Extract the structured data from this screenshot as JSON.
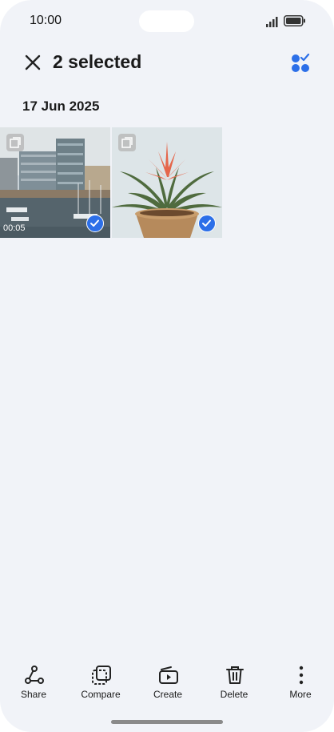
{
  "status": {
    "time": "10:00"
  },
  "header": {
    "title": "2 selected",
    "close_icon": "close-icon",
    "select_all_icon": "select-all-icon"
  },
  "section": {
    "date": "17 Jun 2025"
  },
  "photos": [
    {
      "kind": "video",
      "duration": "00:05",
      "selected": true,
      "subject": "harbour-buildings"
    },
    {
      "kind": "photo",
      "selected": true,
      "subject": "potted-bromeliad"
    }
  ],
  "toolbar": {
    "share": "Share",
    "compare": "Compare",
    "create": "Create",
    "delete": "Delete",
    "more": "More"
  },
  "colors": {
    "accent": "#2c6fe8",
    "background": "#f1f3f8"
  }
}
